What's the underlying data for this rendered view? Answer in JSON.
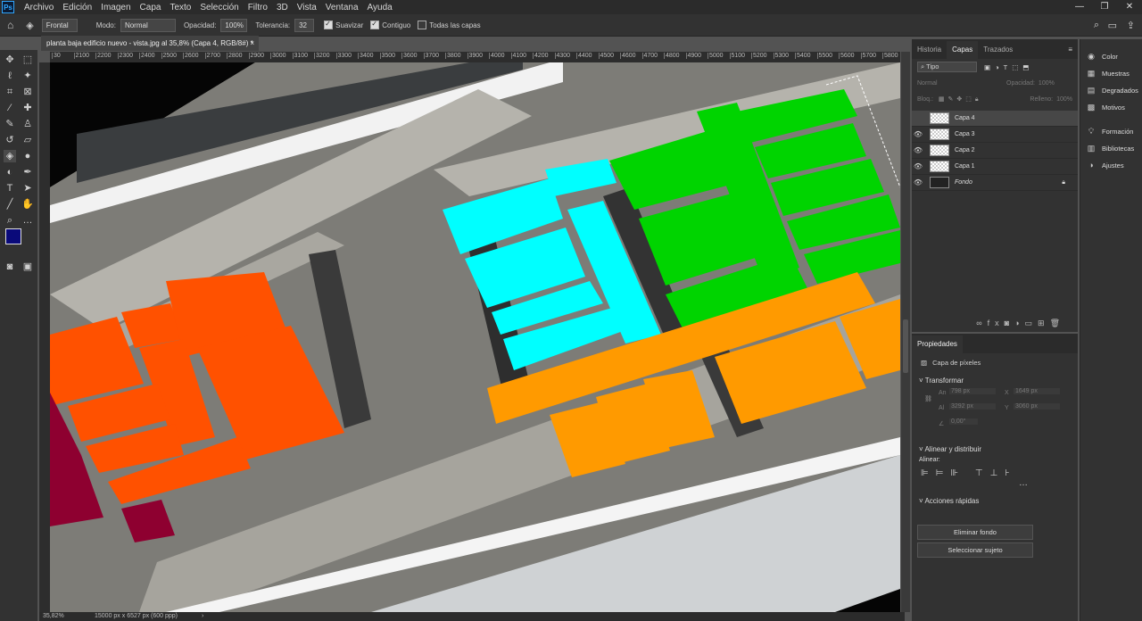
{
  "menubar": {
    "items": [
      "Archivo",
      "Edición",
      "Imagen",
      "Capa",
      "Texto",
      "Selección",
      "Filtro",
      "3D",
      "Vista",
      "Ventana",
      "Ayuda"
    ],
    "window_controls": [
      "—",
      "❐",
      "✕"
    ]
  },
  "options": {
    "sample": "Frontal",
    "mode_label": "Modo:",
    "mode_value": "Normal",
    "opacity_label": "Opacidad:",
    "opacity_value": "100%",
    "tolerance_label": "Tolerancia:",
    "tolerance_value": "32",
    "smooth_label": "Suavizar",
    "contiguous_label": "Contiguo",
    "all_layers_label": "Todas las capas"
  },
  "document": {
    "tab_title": "planta baja edificio nuevo - vista.jpg al 35,8% (Capa 4, RGB/8#) *",
    "zoom": "35,82%",
    "dimensions": "15000 px x 6527 px (600 ppp)"
  },
  "ruler": {
    "ticks": [
      "30",
      "2100",
      "2200",
      "2300",
      "2400",
      "2500",
      "2600",
      "2700",
      "2800",
      "2900",
      "3000",
      "3100",
      "3200",
      "3300",
      "3400",
      "3500",
      "3600",
      "3700",
      "3800",
      "3900",
      "4000",
      "4100",
      "4200",
      "4300",
      "4400",
      "4500",
      "4600",
      "4700",
      "4800",
      "4900",
      "5000",
      "5100",
      "5200",
      "5300",
      "5400",
      "5500",
      "5600",
      "5700",
      "5800",
      "5900"
    ]
  },
  "layers_panel": {
    "tabs": [
      "Historia",
      "Capas",
      "Trazados"
    ],
    "filter_label": "Tipo",
    "blend_mode": "Normal",
    "opacity_label": "Opacidad:",
    "opacity_value": "100%",
    "lock_label": "Bloq.:",
    "fill_label": "Relleno:",
    "fill_value": "100%",
    "layers": [
      {
        "name": "Capa 4",
        "visible": false,
        "selected": true
      },
      {
        "name": "Capa 3",
        "visible": true,
        "selected": false
      },
      {
        "name": "Capa 2",
        "visible": true,
        "selected": false
      },
      {
        "name": "Capa 1",
        "visible": true,
        "selected": false
      },
      {
        "name": "Fondo",
        "visible": true,
        "selected": false,
        "locked": true
      }
    ]
  },
  "properties_panel": {
    "title": "Propiedades",
    "layer_type": "Capa de píxeles",
    "transform_title": "Transformar",
    "w_label": "An",
    "w_value": "798 px",
    "x_label": "X",
    "x_value": "1649 px",
    "h_label": "Al",
    "h_value": "3292 px",
    "y_label": "Y",
    "y_value": "3060 px",
    "angle_value": "0,00°",
    "align_title": "Alinear y distribuir",
    "align_label": "Alinear:",
    "quick_actions_title": "Acciones rápidas",
    "remove_bg_button": "Eliminar fondo",
    "select_subject_button": "Seleccionar sujeto"
  },
  "dock": {
    "items": [
      "Color",
      "Muestras",
      "Degradados",
      "Motivos",
      "Formación",
      "Bibliotecas",
      "Ajustes"
    ]
  },
  "colors": {
    "foreground": "#0a0a7a",
    "background": "#b0102c",
    "green": "#00d400",
    "cyan": "#00ffff",
    "orange_red": "#ff5100",
    "orange": "#ff9a00",
    "crimson": "#8e0030"
  }
}
